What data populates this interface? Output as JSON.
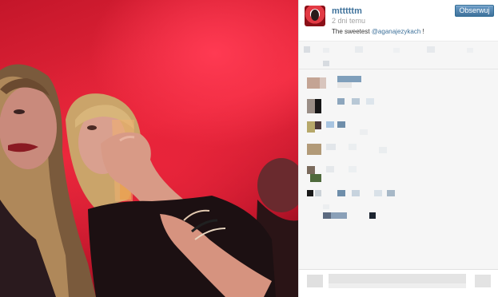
{
  "post": {
    "username": "mtttttm",
    "time_ago": "2 dni temu",
    "follow_label": "Obserwuj",
    "caption_prefix": "The sweetest ",
    "caption_mention": "@aganajezykach",
    "caption_suffix": " !"
  },
  "colors": {
    "link": "#3f729b",
    "follow_button": "#3f729b",
    "photo_red": "#e8243a"
  },
  "icons": {
    "avatar": "profile-avatar"
  }
}
